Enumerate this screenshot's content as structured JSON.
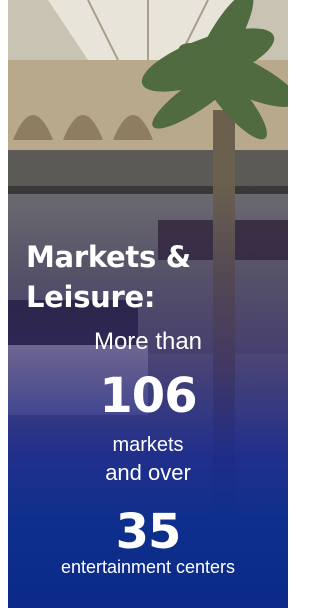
{
  "card": {
    "title_line1": "Markets &",
    "title_line2": "Leisure:",
    "more_than": "More than",
    "markets_count": "106",
    "markets_label": "markets",
    "and_over": "and over",
    "entertainment_count": "35",
    "entertainment_label": "entertainment centers"
  },
  "colors": {
    "bottom_blue": "#0b2a88",
    "text": "#ffffff"
  }
}
